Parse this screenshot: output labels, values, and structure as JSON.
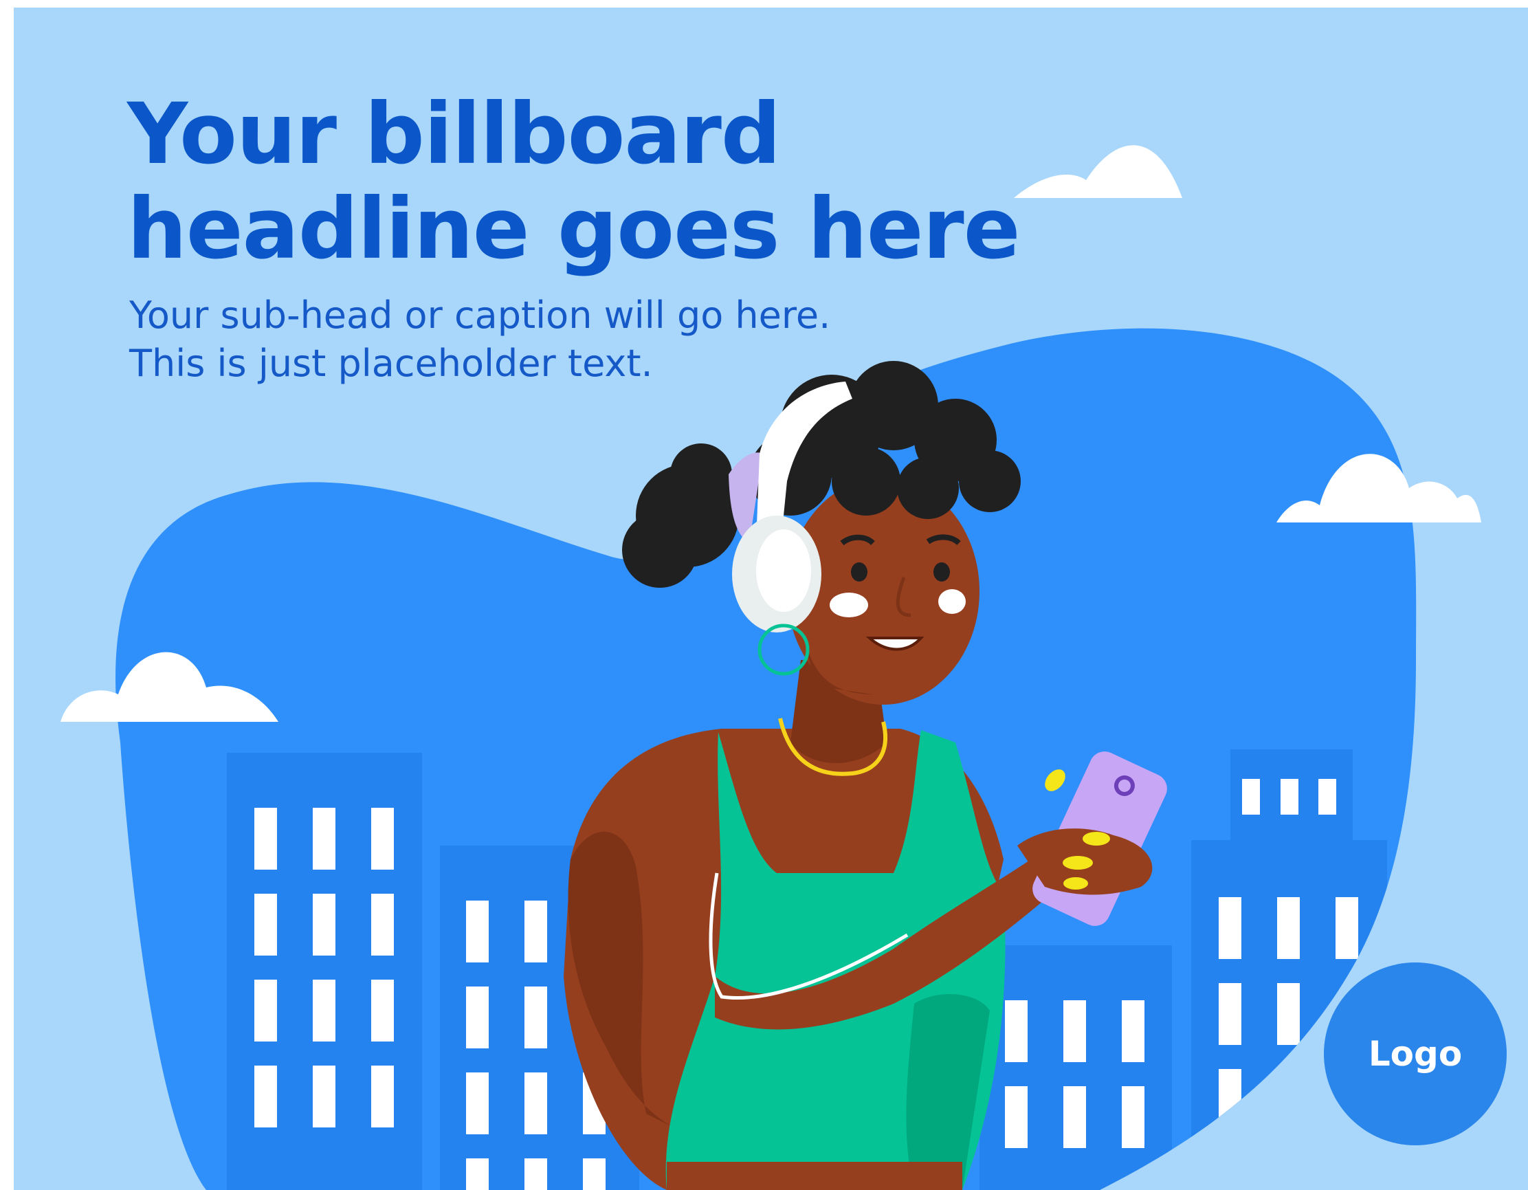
{
  "billboard": {
    "headline_line1": "Your billboard",
    "headline_line2": "headline goes here",
    "subhead_line1": "Your sub-head or caption will go here.",
    "subhead_line2": "This is just placeholder text.",
    "logo_label": "Logo"
  },
  "colors": {
    "background": "#a9d7fb",
    "blob": "#2f90fb",
    "buildings": "#2583ef",
    "headline": "#0b57c9",
    "logo_circle": "#2a86ea"
  }
}
